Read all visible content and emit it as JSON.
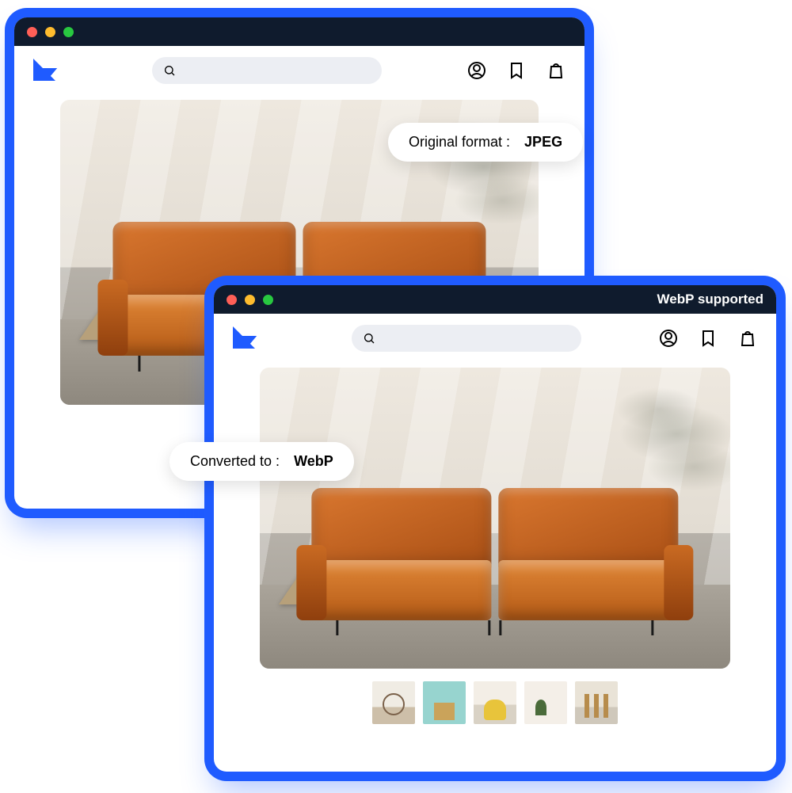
{
  "window_back": {
    "titlebar_label": "",
    "pill": {
      "label": "Original format :",
      "value": "JPEG"
    }
  },
  "window_front": {
    "titlebar_label": "WebP supported",
    "pill": {
      "label": "Converted to :",
      "value": "WebP"
    }
  },
  "icons": {
    "search": "search-icon",
    "account": "account-icon",
    "bookmark": "bookmark-icon",
    "bag": "shopping-bag-icon"
  },
  "thumbnails": [
    "mirror",
    "teal-dresser",
    "yellow-chair",
    "plant",
    "wood-easel"
  ],
  "search_placeholder": ""
}
